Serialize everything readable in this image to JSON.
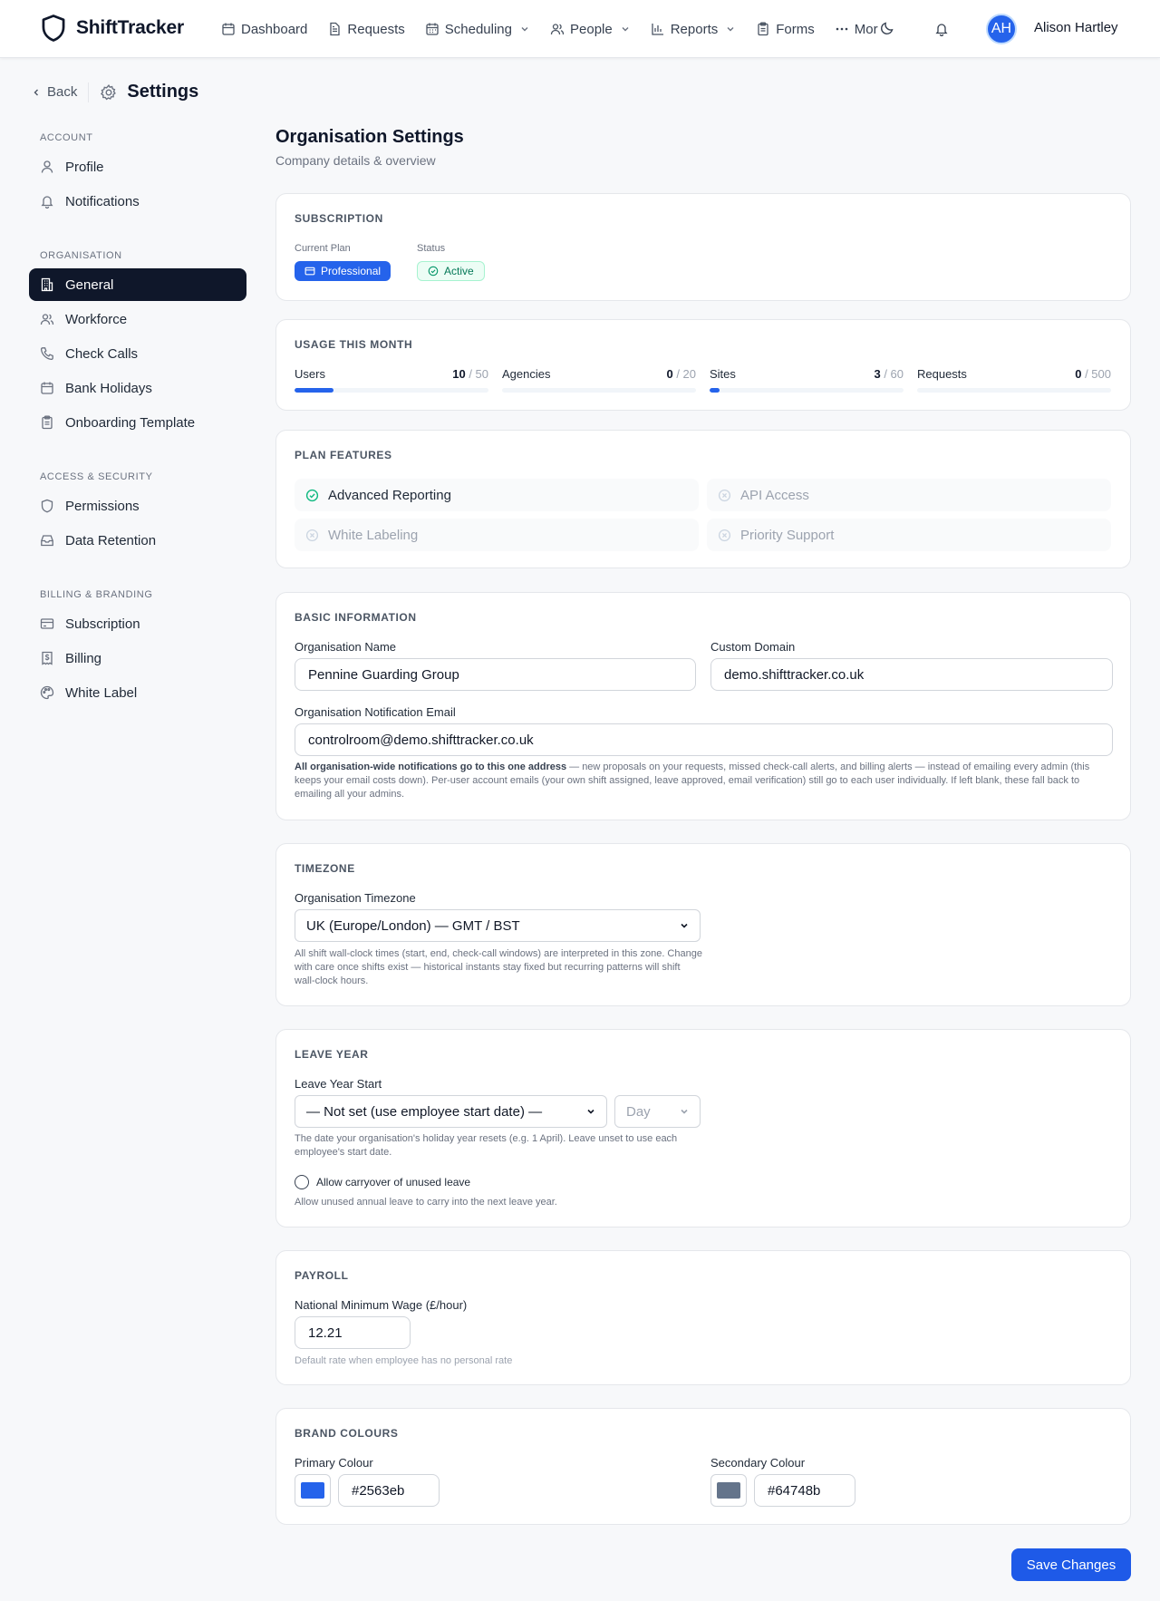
{
  "app": {
    "name": "ShiftTracker"
  },
  "nav": {
    "items": [
      {
        "label": "Dashboard",
        "icon": "calendar-icon",
        "dropdown": false
      },
      {
        "label": "Requests",
        "icon": "document-icon",
        "dropdown": false
      },
      {
        "label": "Scheduling",
        "icon": "calendar-icon",
        "dropdown": true
      },
      {
        "label": "People",
        "icon": "users-icon",
        "dropdown": true
      },
      {
        "label": "Reports",
        "icon": "bar-chart-icon",
        "dropdown": true
      },
      {
        "label": "Forms",
        "icon": "clipboard-icon",
        "dropdown": false
      },
      {
        "label": "Mor",
        "icon": "more-icon",
        "dropdown": false
      }
    ],
    "user": {
      "initials": "AH",
      "name": "Alison Hartley"
    }
  },
  "header": {
    "back": "Back",
    "title": "Settings"
  },
  "sidebar": {
    "sections": [
      {
        "title": "ACCOUNT",
        "items": [
          {
            "label": "Profile"
          },
          {
            "label": "Notifications"
          }
        ]
      },
      {
        "title": "ORGANISATION",
        "items": [
          {
            "label": "General",
            "active": true
          },
          {
            "label": "Workforce"
          },
          {
            "label": "Check Calls"
          },
          {
            "label": "Bank Holidays"
          },
          {
            "label": "Onboarding Template"
          }
        ]
      },
      {
        "title": "ACCESS & SECURITY",
        "items": [
          {
            "label": "Permissions"
          },
          {
            "label": "Data Retention"
          }
        ]
      },
      {
        "title": "BILLING & BRANDING",
        "items": [
          {
            "label": "Subscription"
          },
          {
            "label": "Billing"
          },
          {
            "label": "White Label"
          }
        ]
      }
    ]
  },
  "page": {
    "title": "Organisation Settings",
    "subtitle": "Company details & overview"
  },
  "subscription": {
    "title": "SUBSCRIPTION",
    "plan_label": "Current Plan",
    "plan": "Professional",
    "status_label": "Status",
    "status": "Active"
  },
  "usage": {
    "title": "USAGE THIS MONTH",
    "items": [
      {
        "label": "Users",
        "used": "10",
        "limit": "/ 50",
        "fraction": 0.2
      },
      {
        "label": "Agencies",
        "used": "0",
        "limit": "/ 20",
        "fraction": 0
      },
      {
        "label": "Sites",
        "used": "3",
        "limit": "/ 60",
        "fraction": 0.05
      },
      {
        "label": "Requests",
        "used": "0",
        "limit": "/ 500",
        "fraction": 0
      }
    ]
  },
  "features": {
    "title": "PLAN FEATURES",
    "items": [
      {
        "label": "Advanced Reporting",
        "enabled": true
      },
      {
        "label": "API Access",
        "enabled": false
      },
      {
        "label": "White Labeling",
        "enabled": false
      },
      {
        "label": "Priority Support",
        "enabled": false
      }
    ]
  },
  "basic": {
    "title": "BASIC INFORMATION",
    "org_name_label": "Organisation Name",
    "org_name": "Pennine Guarding Group",
    "domain_label": "Custom Domain",
    "domain": "demo.shifttracker.co.uk",
    "email_label": "Organisation Notification Email",
    "email": "controlroom@demo.shifttracker.co.uk",
    "email_help_bold": "All organisation-wide notifications go to this one address",
    "email_help_rest": " — new proposals on your requests, missed check-call alerts, and billing alerts — instead of emailing every admin (this keeps your email costs down). Per-user account emails (your own shift assigned, leave approved, email verification) still go to each user individually. If left blank, these fall back to emailing all your admins."
  },
  "timezone": {
    "title": "TIMEZONE",
    "label": "Organisation Timezone",
    "value": "UK (Europe/London) — GMT / BST",
    "help": "All shift wall-clock times (start, end, check-call windows) are interpreted in this zone. Change with care once shifts exist — historical instants stay fixed but recurring patterns will shift wall-clock hours."
  },
  "leave": {
    "title": "LEAVE YEAR",
    "label": "Leave Year Start",
    "month_value": "— Not set (use employee start date) —",
    "day_placeholder": "Day",
    "help": "The date your organisation's holiday year resets (e.g. 1 April). Leave unset to use each employee's start date.",
    "carryover_label": "Allow carryover of unused leave",
    "carryover_help": "Allow unused annual leave to carry into the next leave year."
  },
  "payroll": {
    "title": "PAYROLL",
    "label": "National Minimum Wage (£/hour)",
    "value": "12.21",
    "help": "Default rate when employee has no personal rate"
  },
  "brand": {
    "title": "BRAND COLOURS",
    "primary_label": "Primary Colour",
    "primary": "#2563eb",
    "secondary_label": "Secondary Colour",
    "secondary": "#64748b"
  },
  "actions": {
    "save": "Save Changes"
  },
  "colors": {
    "accent": "#2563eb",
    "sidebar_active": "#0f172a",
    "success": "#047857"
  }
}
